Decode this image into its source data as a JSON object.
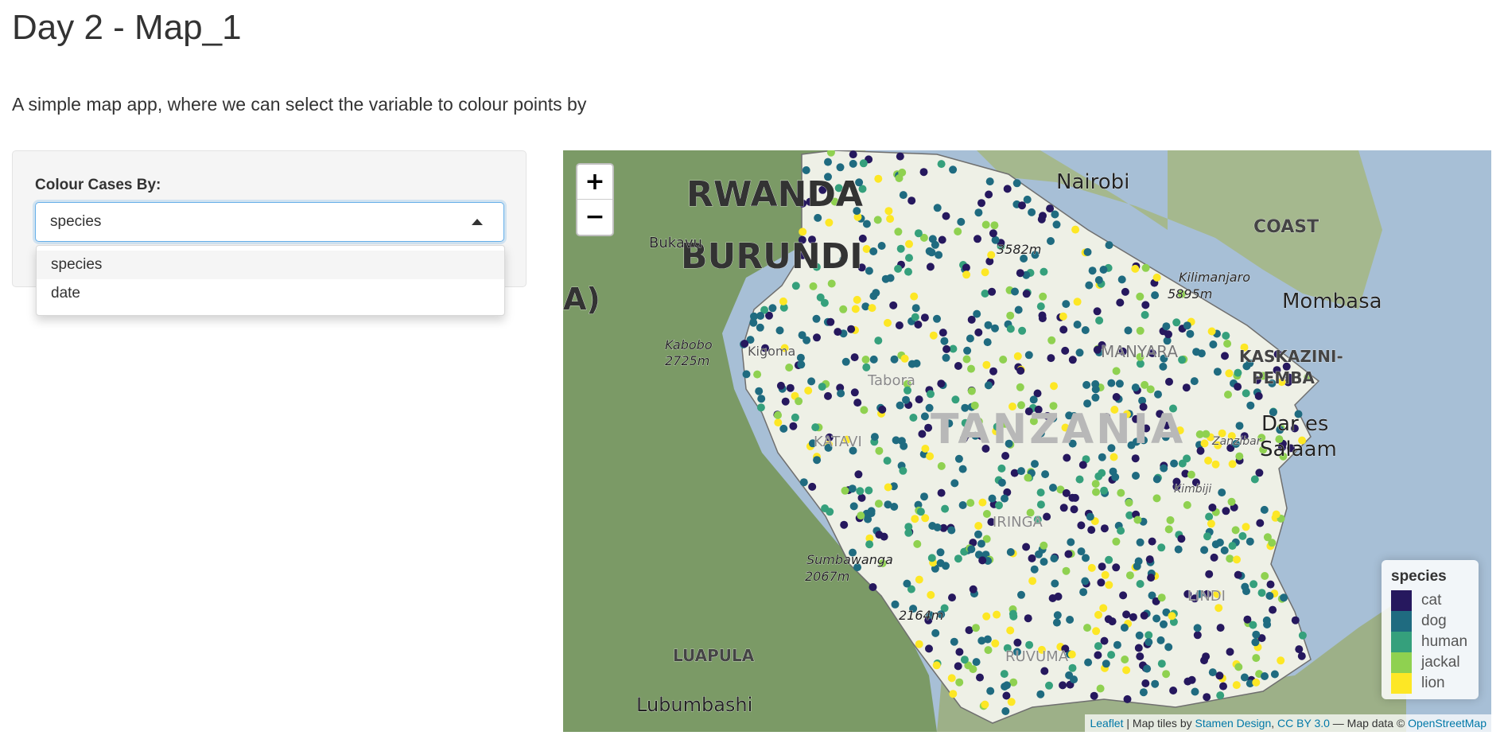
{
  "page": {
    "title": "Day 2 - Map_1",
    "description": "A simple map app, where we can select the variable to colour points by"
  },
  "sidebar": {
    "control_label": "Colour Cases By:",
    "select_value": "species",
    "options": [
      {
        "label": "species",
        "selected": true
      },
      {
        "label": "date",
        "selected": false
      }
    ]
  },
  "map": {
    "zoom_in_label": "+",
    "zoom_out_label": "−",
    "place_labels": [
      "RWANDA",
      "BURUNDI",
      "A)",
      "Bukavu",
      "Kabobo",
      "2725m",
      "Nairobi",
      "COAST",
      "Mombasa",
      "Kilimanjaro",
      "5895m",
      "3582m",
      "MANYARA",
      "KASKAZINI-",
      "PEMBA",
      "Dar es",
      "Salaam",
      "TANZANIA",
      "KATAVI",
      "Tabora",
      "Kigoma",
      "IRINGA",
      "Sumbawanga",
      "2067m",
      "2164m",
      "LINDI",
      "RUVUMA",
      "LUAPULA",
      "Lubumbashi",
      "Zanzibar",
      "Kimbiji"
    ],
    "legend": {
      "title": "species",
      "items": [
        {
          "label": "cat",
          "color": "#26185e"
        },
        {
          "label": "dog",
          "color": "#1f6b80"
        },
        {
          "label": "human",
          "color": "#35a07c"
        },
        {
          "label": "jackal",
          "color": "#8fd150"
        },
        {
          "label": "lion",
          "color": "#fde725"
        }
      ]
    },
    "attribution": {
      "leaflet": "Leaflet",
      "sep1": " | Map tiles by ",
      "stamen": "Stamen Design",
      "sep2": ", ",
      "cc": "CC BY 3.0",
      "sep3": " — Map data © ",
      "osm": "OpenStreetMap"
    },
    "colors": {
      "water": "#a7bfd6",
      "land": "#7b9a66",
      "tanzania": "#eef0e6"
    }
  }
}
